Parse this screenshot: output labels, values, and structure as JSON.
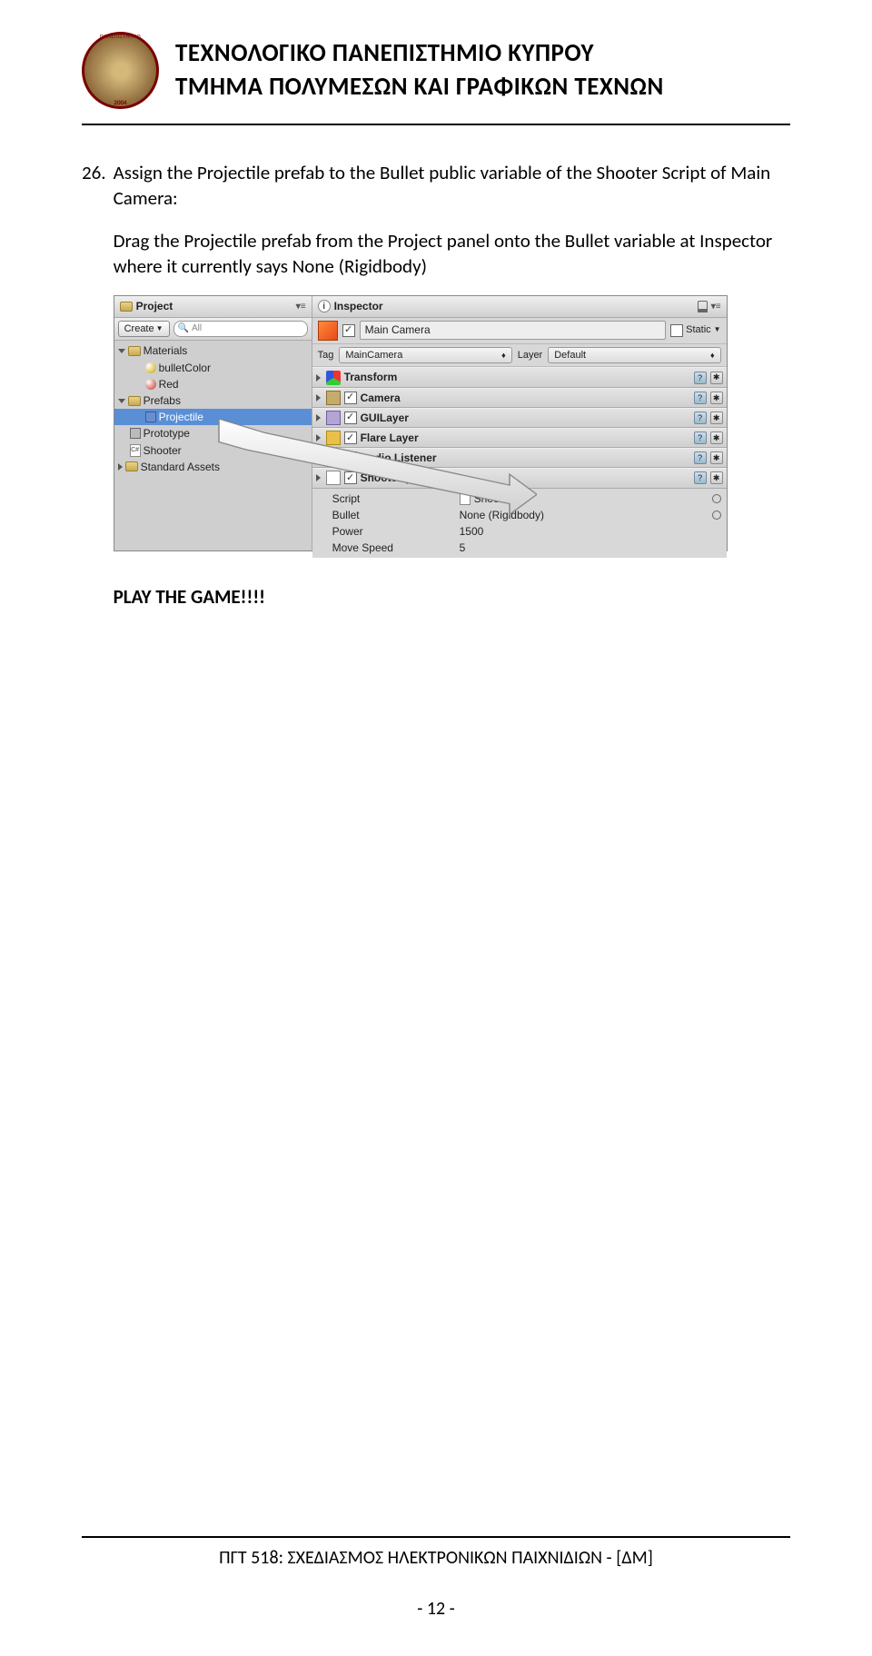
{
  "header": {
    "line1": "ΤΕΧΝΟΛΟΓΙΚΟ ΠΑΝΕΠΙΣΤΗΜΙΟ ΚΥΠΡΟΥ",
    "line2": "ΤΜΗΜΑ ΠΟΛΥΜΕΣΩΝ ΚΑΙ ΓΡΑΦΙΚΩΝ ΤΕΧΝΩΝ",
    "logo_year": "2004"
  },
  "step": {
    "num": "26.",
    "title": "Assign the Projectile prefab to the Bullet public variable of the Shooter Script of Main Camera:",
    "desc": "Drag the Projectile prefab from the Project panel onto the Bullet variable at Inspector where it currently says None (Rigidbody)"
  },
  "screenshot": {
    "project_panel": {
      "title": "Project",
      "create_btn": "Create",
      "search_placeholder": "All",
      "tree": [
        {
          "type": "folder",
          "expand": "down",
          "depth": 0,
          "label": "Materials"
        },
        {
          "type": "sphere",
          "color": "#c9a400",
          "depth": 1,
          "label": "bulletColor"
        },
        {
          "type": "sphere",
          "color": "#c83020",
          "depth": 1,
          "label": "Red"
        },
        {
          "type": "folder",
          "expand": "down",
          "depth": 0,
          "label": "Prefabs"
        },
        {
          "type": "prefab",
          "depth": 1,
          "label": "Projectile",
          "selected": true
        },
        {
          "type": "cube",
          "depth": 0,
          "label": "Prototype"
        },
        {
          "type": "cs",
          "depth": 0,
          "label": "Shooter"
        },
        {
          "type": "folder",
          "expand": "right",
          "depth": 0,
          "label": "Standard Assets"
        }
      ]
    },
    "inspector": {
      "title": "Inspector",
      "object_name": "Main Camera",
      "static_label": "Static",
      "tag_label": "Tag",
      "tag_value": "MainCamera",
      "layer_label": "Layer",
      "layer_value": "Default",
      "components": [
        {
          "name": "Transform",
          "icon": "ci-transform",
          "check": false
        },
        {
          "name": "Camera",
          "icon": "ci-camera",
          "check": true
        },
        {
          "name": "GUILayer",
          "icon": "ci-gui",
          "check": true
        },
        {
          "name": "Flare Layer",
          "icon": "ci-flare",
          "check": true
        },
        {
          "name": "Audio Listener",
          "icon": "ci-audio",
          "check": true
        },
        {
          "name": "Shooter (Script)",
          "icon": "ci-script",
          "check": true,
          "expanded": true
        }
      ],
      "fields": [
        {
          "label": "Script",
          "value": "Shooter",
          "doc": true,
          "circ": true
        },
        {
          "label": "Bullet",
          "value": "None (Rigidbody)",
          "doc": false,
          "circ": true
        },
        {
          "label": "Power",
          "value": "1500",
          "doc": false,
          "circ": false
        },
        {
          "label": "Move Speed",
          "value": "5",
          "doc": false,
          "circ": false
        }
      ]
    }
  },
  "play": "PLAY THE GAME!!!!",
  "footer": {
    "text": "ΠΓΤ 518: ΣΧΕΔΙΑΣΜΟΣ ΗΛΕΚΤΡΟΝΙΚΩΝ ΠΑΙΧΝΙΔΙΩΝ - [ΔΜ]",
    "page": "- 12 -"
  }
}
